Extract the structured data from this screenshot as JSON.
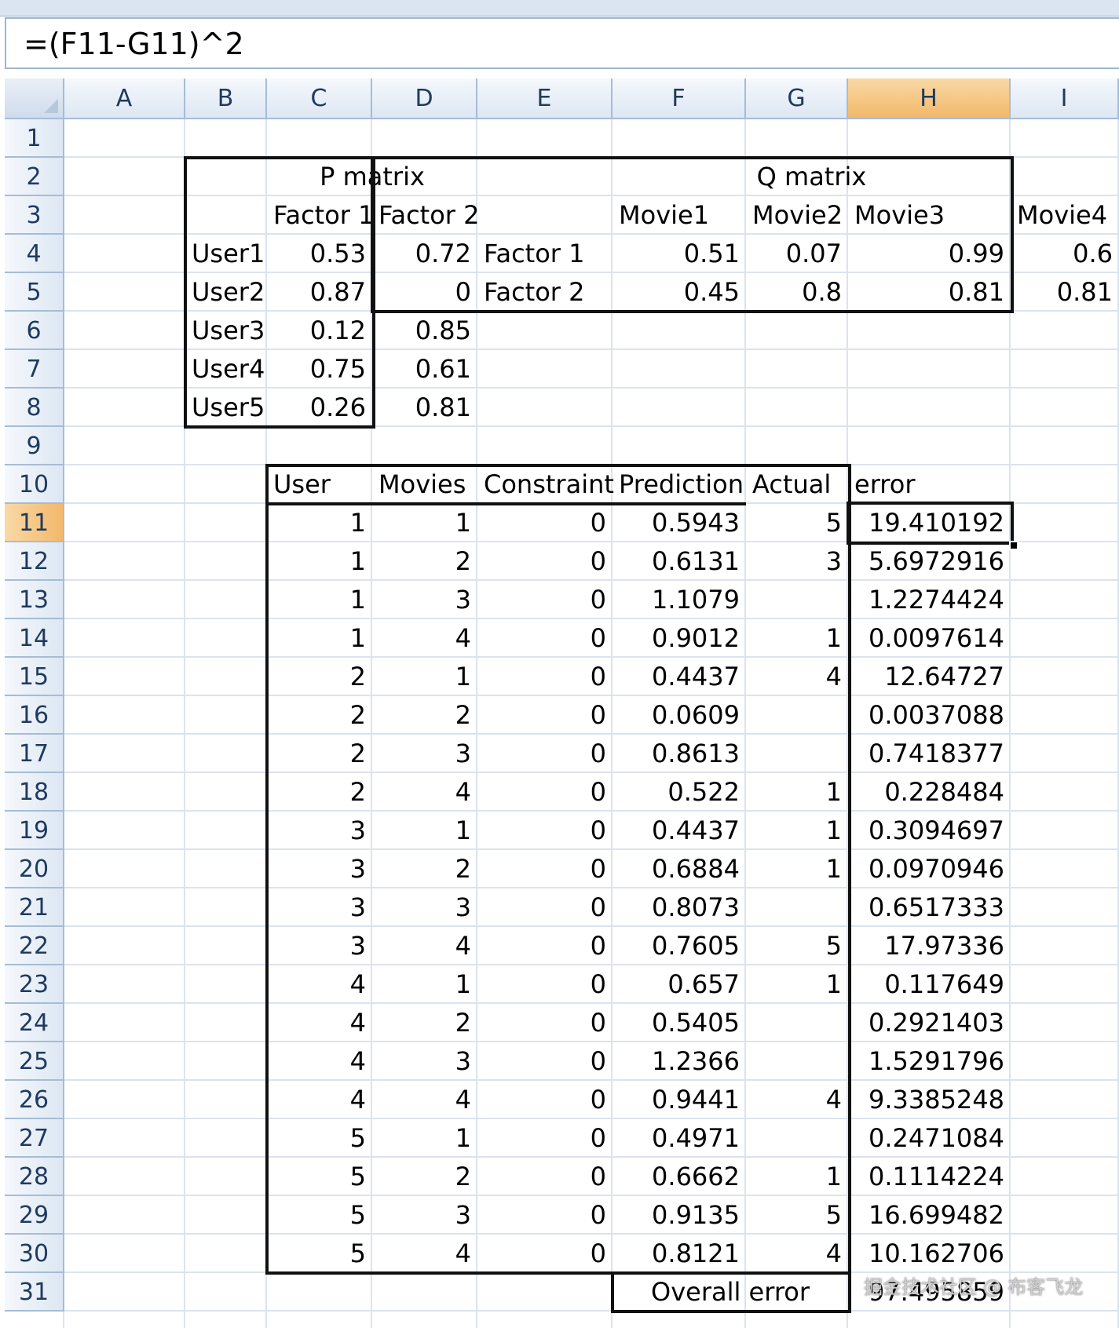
{
  "formula_bar": {
    "text": "=(F11-G11)^2"
  },
  "columns": [
    "A",
    "B",
    "C",
    "D",
    "E",
    "F",
    "G",
    "H",
    "I"
  ],
  "selected_column": "H",
  "rows": [
    "1",
    "2",
    "3",
    "4",
    "5",
    "6",
    "7",
    "8",
    "9",
    "10",
    "11",
    "12",
    "13",
    "14",
    "15",
    "16",
    "17",
    "18",
    "19",
    "20",
    "21",
    "22",
    "23",
    "24",
    "25",
    "26",
    "27",
    "28",
    "29",
    "30",
    "31"
  ],
  "selected_row": "11",
  "p_matrix": {
    "title": "P matrix",
    "headers": [
      "Factor 1",
      "Factor 2"
    ],
    "rows": [
      {
        "label": "User1",
        "values": [
          "0.53",
          "0.72"
        ]
      },
      {
        "label": "User2",
        "values": [
          "0.87",
          "0"
        ]
      },
      {
        "label": "User3",
        "values": [
          "0.12",
          "0.85"
        ]
      },
      {
        "label": "User4",
        "values": [
          "0.75",
          "0.61"
        ]
      },
      {
        "label": "User5",
        "values": [
          "0.26",
          "0.81"
        ]
      }
    ]
  },
  "q_matrix": {
    "title": "Q matrix",
    "headers": [
      "Movie1",
      "Movie2",
      "Movie3",
      "Movie4"
    ],
    "rows": [
      {
        "label": "Factor 1",
        "values": [
          "0.51",
          "0.07",
          "0.99",
          "0.6"
        ]
      },
      {
        "label": "Factor 2",
        "values": [
          "0.45",
          "0.8",
          "0.81",
          "0.81"
        ]
      }
    ]
  },
  "table": {
    "headers": [
      "User",
      "Movies",
      "Constraint",
      "Prediction",
      "Actual",
      "error"
    ],
    "rows": [
      [
        "1",
        "1",
        "0",
        "0.5943",
        "5",
        "19.410192"
      ],
      [
        "1",
        "2",
        "0",
        "0.6131",
        "3",
        "5.6972916"
      ],
      [
        "1",
        "3",
        "0",
        "1.1079",
        "",
        "1.2274424"
      ],
      [
        "1",
        "4",
        "0",
        "0.9012",
        "1",
        "0.0097614"
      ],
      [
        "2",
        "1",
        "0",
        "0.4437",
        "4",
        "12.64727"
      ],
      [
        "2",
        "2",
        "0",
        "0.0609",
        "",
        "0.0037088"
      ],
      [
        "2",
        "3",
        "0",
        "0.8613",
        "",
        "0.7418377"
      ],
      [
        "2",
        "4",
        "0",
        "0.522",
        "1",
        "0.228484"
      ],
      [
        "3",
        "1",
        "0",
        "0.4437",
        "1",
        "0.3094697"
      ],
      [
        "3",
        "2",
        "0",
        "0.6884",
        "1",
        "0.0970946"
      ],
      [
        "3",
        "3",
        "0",
        "0.8073",
        "",
        "0.6517333"
      ],
      [
        "3",
        "4",
        "0",
        "0.7605",
        "5",
        "17.97336"
      ],
      [
        "4",
        "1",
        "0",
        "0.657",
        "1",
        "0.117649"
      ],
      [
        "4",
        "2",
        "0",
        "0.5405",
        "",
        "0.2921403"
      ],
      [
        "4",
        "3",
        "0",
        "1.2366",
        "",
        "1.5291796"
      ],
      [
        "4",
        "4",
        "0",
        "0.9441",
        "4",
        "9.3385248"
      ],
      [
        "5",
        "1",
        "0",
        "0.4971",
        "",
        "0.2471084"
      ],
      [
        "5",
        "2",
        "0",
        "0.6662",
        "1",
        "0.1114224"
      ],
      [
        "5",
        "3",
        "0",
        "0.9135",
        "5",
        "16.699482"
      ],
      [
        "5",
        "4",
        "0",
        "0.8121",
        "4",
        "10.162706"
      ]
    ],
    "overall_label": "Overall error",
    "overall_value": "97.495859"
  },
  "watermark": "掘金技术社区 @ 布客飞龙"
}
